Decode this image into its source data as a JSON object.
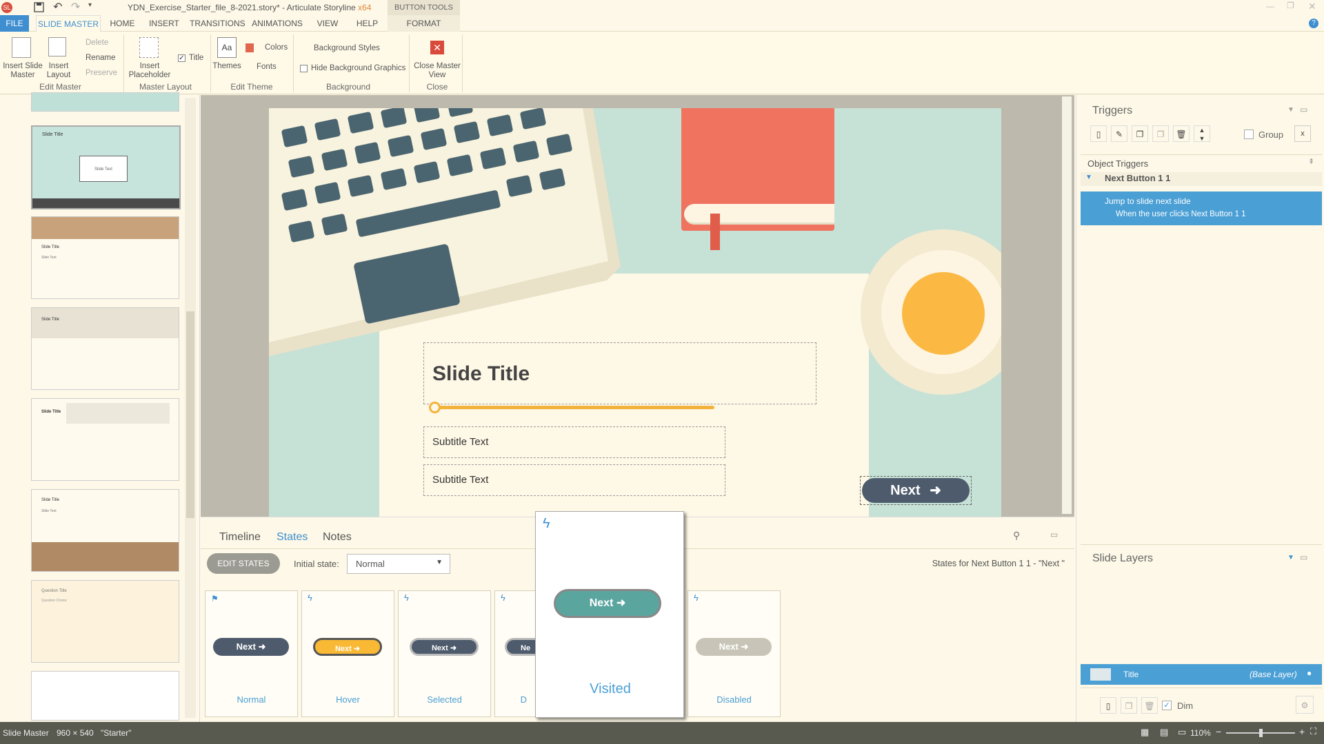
{
  "app": {
    "window_title": "YDN_Exercise_Starter_file_8-2021.story* - Articulate Storyline",
    "arch": "x64"
  },
  "ribbon": {
    "context_group": "BUTTON TOOLS",
    "tabs": [
      "FILE",
      "SLIDE MASTER",
      "HOME",
      "INSERT",
      "TRANSITIONS",
      "ANIMATIONS",
      "VIEW",
      "HELP",
      "FORMAT"
    ],
    "buttons": {
      "insert_slide_master": "Insert Slide Master",
      "insert_layout": "Insert Layout",
      "delete": "Delete",
      "rename": "Rename",
      "preserve": "Preserve",
      "insert_placeholder": "Insert Placeholder",
      "title_check": "Title",
      "themes": "Themes",
      "colors": "Colors",
      "fonts": "Fonts",
      "background_styles": "Background Styles",
      "hide_background": "Hide Background Graphics",
      "close_master": "Close Master View"
    },
    "groups": [
      "Edit Master",
      "Master Layout",
      "Edit Theme",
      "Background",
      "Close"
    ]
  },
  "left_panel": {
    "thumb_titles": [
      "Slide Title",
      "Slide Title",
      "Slide Title",
      "Slide Title",
      "Slide Title",
      "Question Title"
    ],
    "thumb_sub": [
      "Slide Text",
      "Slide Text",
      "",
      "",
      "Slide Text",
      "Question Choice"
    ]
  },
  "slide": {
    "title": "Slide Title",
    "subtitle1": "Subtitle Text",
    "subtitle2": "Subtitle Text",
    "next_button": "Next"
  },
  "bottom": {
    "tabs": [
      "Timeline",
      "States",
      "Notes"
    ],
    "edit_states": "EDIT STATES",
    "initial_state_label": "Initial state:",
    "initial_state_value": "Normal",
    "states_for": "States for Next Button 1 1 - \"Next \"",
    "states": [
      {
        "name": "Normal",
        "label": "Next"
      },
      {
        "name": "Hover",
        "label": "Next"
      },
      {
        "name": "Selected",
        "label": "Next"
      },
      {
        "name": "D",
        "label": "Ne"
      },
      {
        "name": "Disabled",
        "label": "Next"
      }
    ],
    "popup_state": {
      "name": "Visited",
      "label": "Next"
    }
  },
  "right_panel": {
    "triggers_title": "Triggers",
    "group_label": "Group",
    "object_triggers": "Object Triggers",
    "object_name": "Next Button 1 1",
    "trigger_action": "Jump to slide next slide",
    "trigger_condition": "When the user clicks Next Button 1 1",
    "slide_layers_title": "Slide Layers",
    "layer_name": "Title",
    "layer_tag": "(Base Layer)",
    "dim_label": "Dim"
  },
  "status": {
    "mode": "Slide Master",
    "size": "960 × 540",
    "theme": "\"Starter\"",
    "zoom": "110%"
  },
  "colors": {
    "accent_blue": "#4a9fd5",
    "button_dark": "#4e5b6d",
    "hover_yellow": "#f9b934",
    "visited_teal": "#5ba59f",
    "salmon": "#ef735f"
  }
}
